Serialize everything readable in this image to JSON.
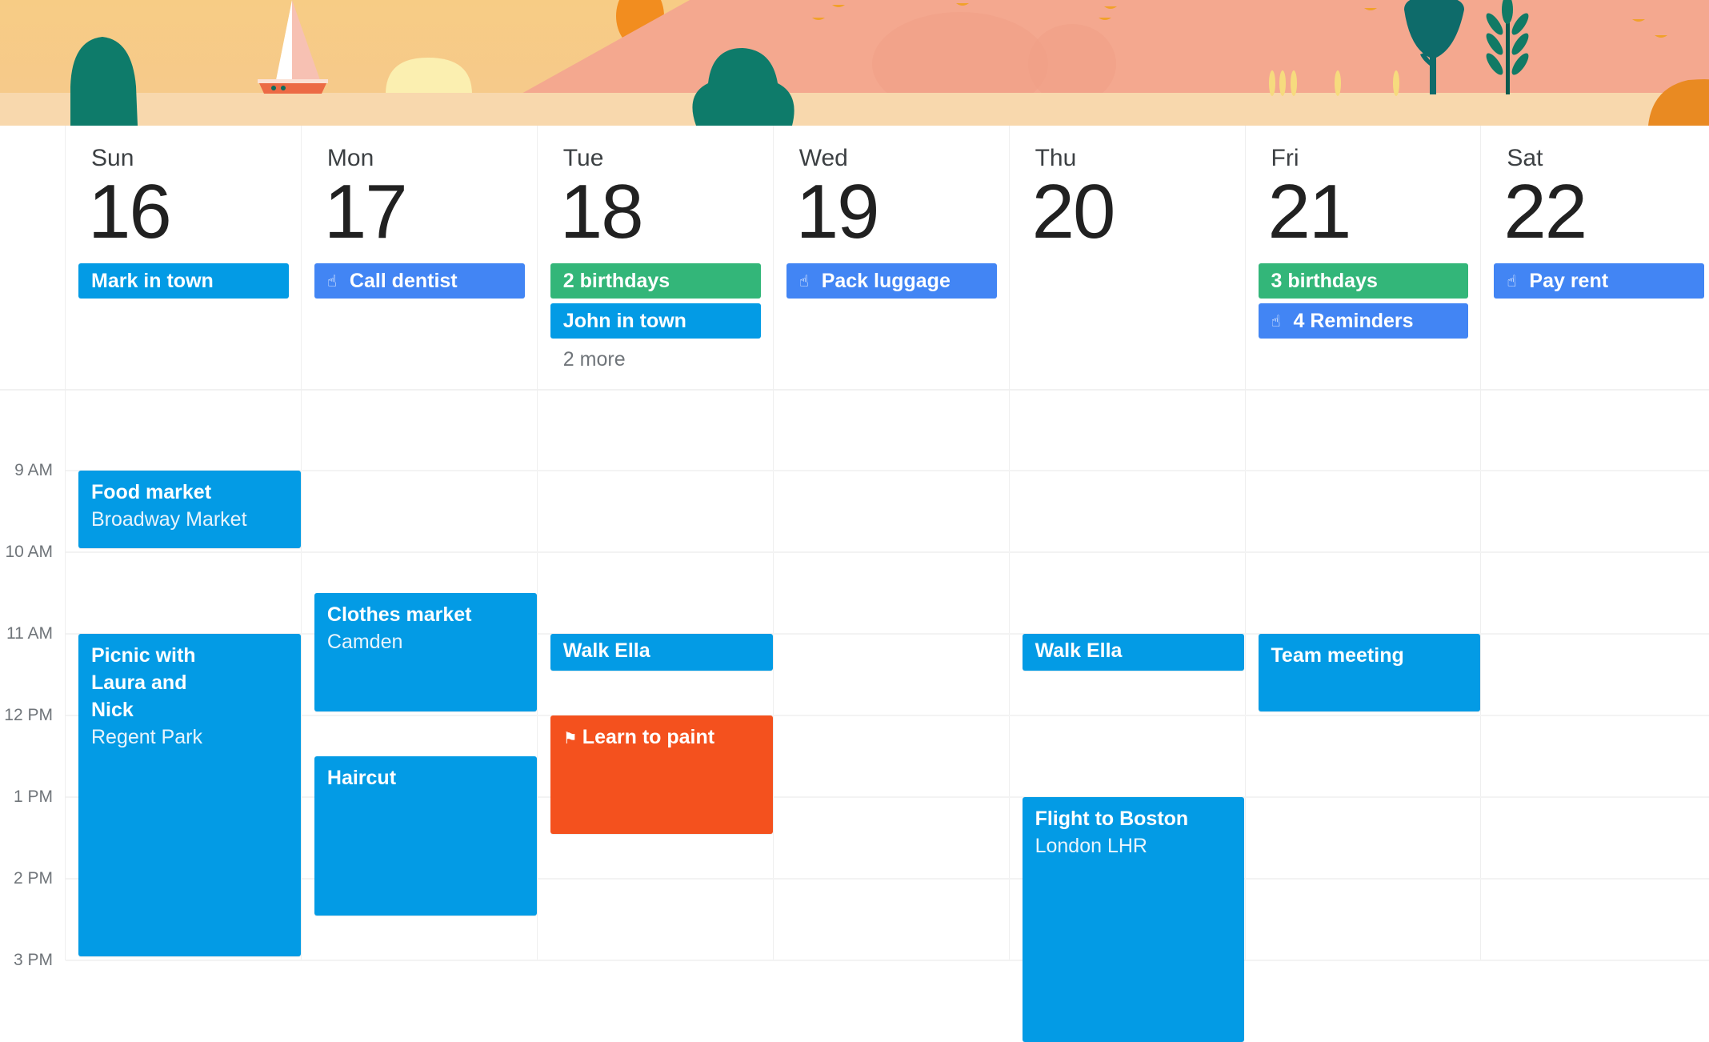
{
  "colors": {
    "event_blue": "#039be5",
    "reminder_blue": "#4285f4",
    "birthday_green": "#33b679",
    "paint_orange": "#f4511e",
    "text_dark": "#212121",
    "text_muted": "#70757a",
    "sky": "#f8cf8d",
    "hill": "#f5a990",
    "sand": "#f9dbb0",
    "tree": "#0e7b6a"
  },
  "banner": {
    "theme": "summer-landscape-illustration"
  },
  "days": [
    {
      "name": "Sun",
      "date": "16",
      "all_day": [
        {
          "label": "Mark in town",
          "type": "event",
          "icon": ""
        }
      ],
      "more": ""
    },
    {
      "name": "Mon",
      "date": "17",
      "all_day": [
        {
          "label": "Call dentist",
          "type": "reminder",
          "icon": "reminder-hand-icon"
        }
      ],
      "more": ""
    },
    {
      "name": "Tue",
      "date": "18",
      "all_day": [
        {
          "label": "2 birthdays",
          "type": "birthday",
          "icon": ""
        },
        {
          "label": "John in town",
          "type": "event",
          "icon": ""
        }
      ],
      "more": "2 more"
    },
    {
      "name": "Wed",
      "date": "19",
      "all_day": [
        {
          "label": "Pack luggage",
          "type": "reminder",
          "icon": "reminder-hand-icon"
        }
      ],
      "more": ""
    },
    {
      "name": "Thu",
      "date": "20",
      "all_day": [],
      "more": ""
    },
    {
      "name": "Fri",
      "date": "21",
      "all_day": [
        {
          "label": "3 birthdays",
          "type": "birthday",
          "icon": ""
        },
        {
          "label": "4 Reminders",
          "type": "reminder",
          "icon": "reminder-hand-icon"
        }
      ],
      "more": ""
    },
    {
      "name": "Sat",
      "date": "22",
      "all_day": [
        {
          "label": "Pay rent",
          "type": "reminder",
          "icon": "reminder-hand-icon"
        }
      ],
      "more": ""
    }
  ],
  "hours": [
    "9 AM",
    "10 AM",
    "11 AM",
    "12 PM",
    "1 PM",
    "2 PM",
    "3 PM"
  ],
  "events": [
    {
      "day": 0,
      "title": "Food market",
      "location": "Broadway Market",
      "start": 9.0,
      "end": 9.95,
      "type": "event",
      "icon": ""
    },
    {
      "day": 0,
      "title": "Picnic with Laura and Nick",
      "location": "Regent Park",
      "start": 11.0,
      "end": 14.95,
      "type": "event",
      "icon": ""
    },
    {
      "day": 1,
      "title": "Clothes market",
      "location": "Camden",
      "start": 10.5,
      "end": 11.95,
      "type": "event",
      "icon": ""
    },
    {
      "day": 1,
      "title": "Haircut",
      "location": "",
      "start": 12.5,
      "end": 14.45,
      "type": "event",
      "icon": ""
    },
    {
      "day": 2,
      "title": "Walk Ella",
      "location": "",
      "start": 11.0,
      "end": 11.45,
      "type": "event",
      "icon": ""
    },
    {
      "day": 2,
      "title": "Learn to paint",
      "location": "",
      "start": 12.0,
      "end": 13.45,
      "type": "goal",
      "icon": "flag-icon"
    },
    {
      "day": 4,
      "title": "Walk Ella",
      "location": "",
      "start": 11.0,
      "end": 11.45,
      "type": "event",
      "icon": ""
    },
    {
      "day": 4,
      "title": "Flight to Boston",
      "location": "London LHR",
      "start": 13.0,
      "end": 16.0,
      "type": "event",
      "icon": ""
    },
    {
      "day": 5,
      "title": "Team meeting",
      "location": "",
      "start": 11.0,
      "end": 11.95,
      "type": "event",
      "icon": ""
    }
  ]
}
